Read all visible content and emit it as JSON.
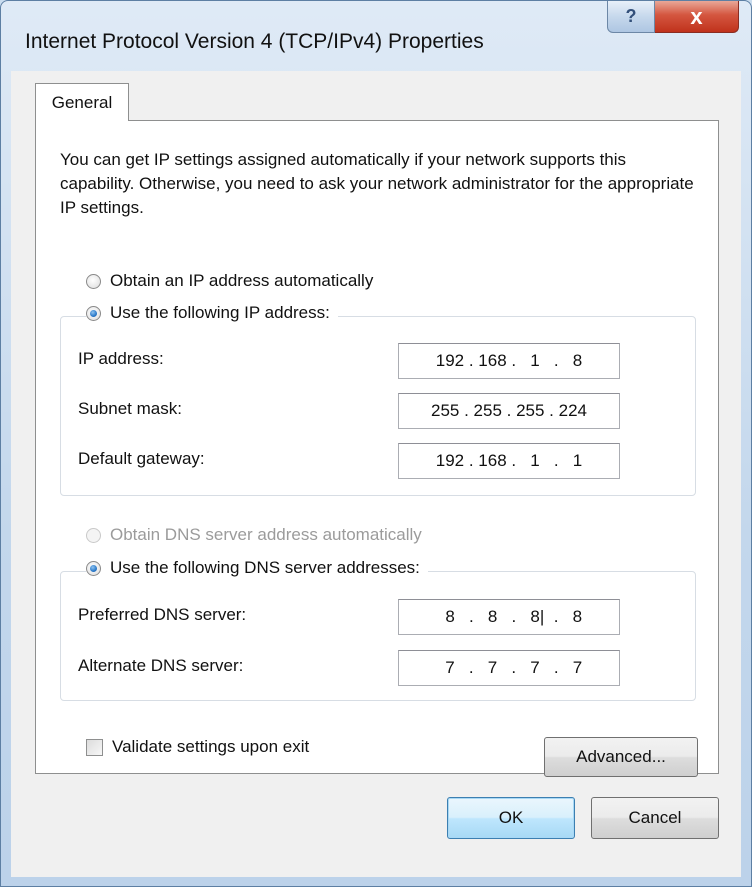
{
  "window": {
    "title": "Internet Protocol Version 4 (TCP/IPv4) Properties",
    "help_glyph": "?",
    "close_glyph": "x"
  },
  "tab": {
    "label": "General"
  },
  "intro_text": "You can get IP settings assigned automatically if your network supports this capability. Otherwise, you need to ask your network administrator for the appropriate IP settings.",
  "ip_mode": {
    "auto_label": "Obtain an IP address automatically",
    "manual_label": "Use the following IP address:",
    "selected": "manual"
  },
  "ip_fields": {
    "ip_label": "IP address:",
    "ip_value": "192 . 168 .   1   .   8",
    "subnet_label": "Subnet mask:",
    "subnet_value": "255 . 255 . 255 . 224",
    "gateway_label": "Default gateway:",
    "gateway_value": "192 . 168 .   1   .   1"
  },
  "dns_mode": {
    "auto_label": "Obtain DNS server address automatically",
    "auto_disabled": true,
    "manual_label": "Use the following DNS server addresses:",
    "selected": "manual"
  },
  "dns_fields": {
    "preferred_label": "Preferred DNS server:",
    "preferred_value": "  8   .   8   .   8|  .   8",
    "alternate_label": "Alternate DNS server:",
    "alternate_value": "  7   .   7   .   7   .   7"
  },
  "validate": {
    "label": "Validate settings upon exit",
    "checked": false
  },
  "buttons": {
    "advanced": "Advanced...",
    "ok": "OK",
    "cancel": "Cancel"
  }
}
